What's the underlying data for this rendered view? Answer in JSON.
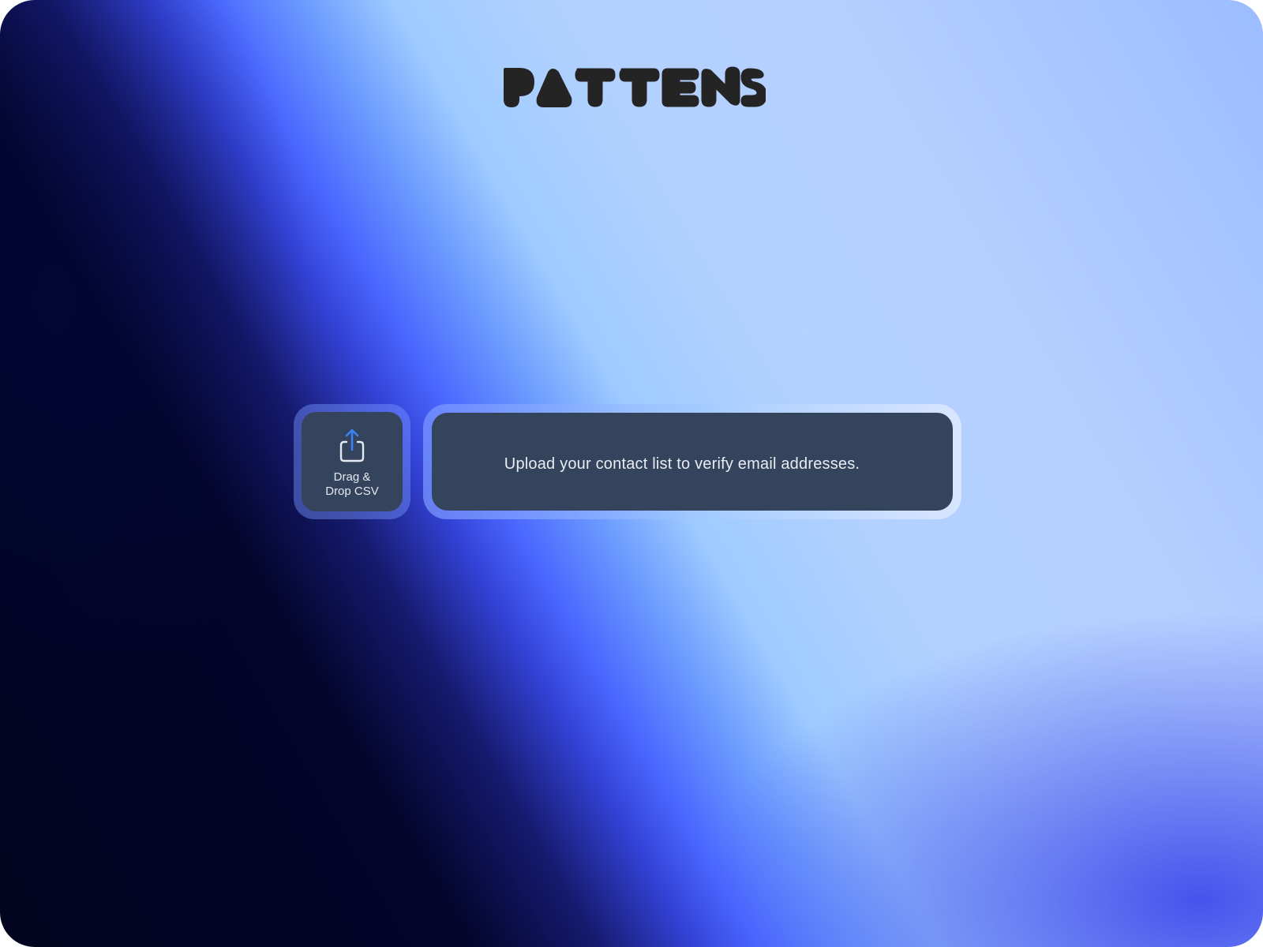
{
  "brand": {
    "logo_text": "PATTENS",
    "logo_color": "#242424"
  },
  "upload": {
    "icon": "upload-share-icon",
    "label_line1": "Drag &",
    "label_line2": "Drop CSV",
    "accent_color": "#3b82f6"
  },
  "message": {
    "text": "Upload your contact list to verify email addresses."
  },
  "colors": {
    "panel_bg": "#35445d",
    "background_dark": "#02041f",
    "background_blue": "#4a68ff",
    "background_light": "#b3d1ff"
  }
}
